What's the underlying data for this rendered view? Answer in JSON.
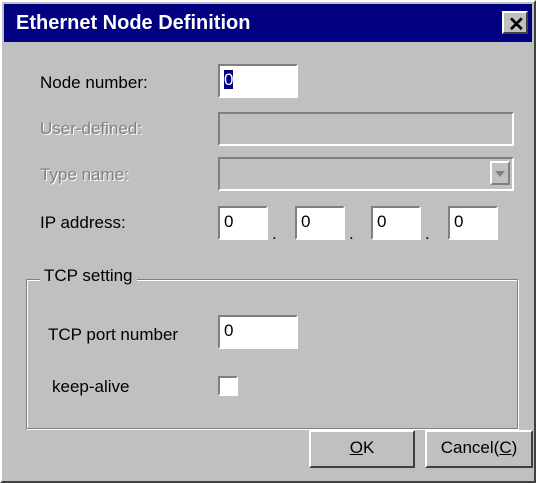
{
  "window": {
    "title": "Ethernet Node Definition",
    "close_glyph": "✕"
  },
  "form": {
    "node_number_label": "Node number:",
    "node_number_value": "0",
    "user_defined_label": "User-defined:",
    "user_defined_value": "",
    "type_name_label": "Type name:",
    "type_name_value": "",
    "ip_label": "IP address:",
    "ip": [
      "0",
      "0",
      "0",
      "0"
    ],
    "ip_separator": "."
  },
  "tcp": {
    "group_label": "TCP setting",
    "port_label": "TCP port number",
    "port_value": "0",
    "keepalive_label": "keep-alive",
    "keepalive_checked": false
  },
  "buttons": {
    "ok_mnemonic": "O",
    "ok_rest": "K",
    "cancel_prefix": "Cancel(",
    "cancel_mnemonic": "C",
    "cancel_suffix": ")"
  }
}
